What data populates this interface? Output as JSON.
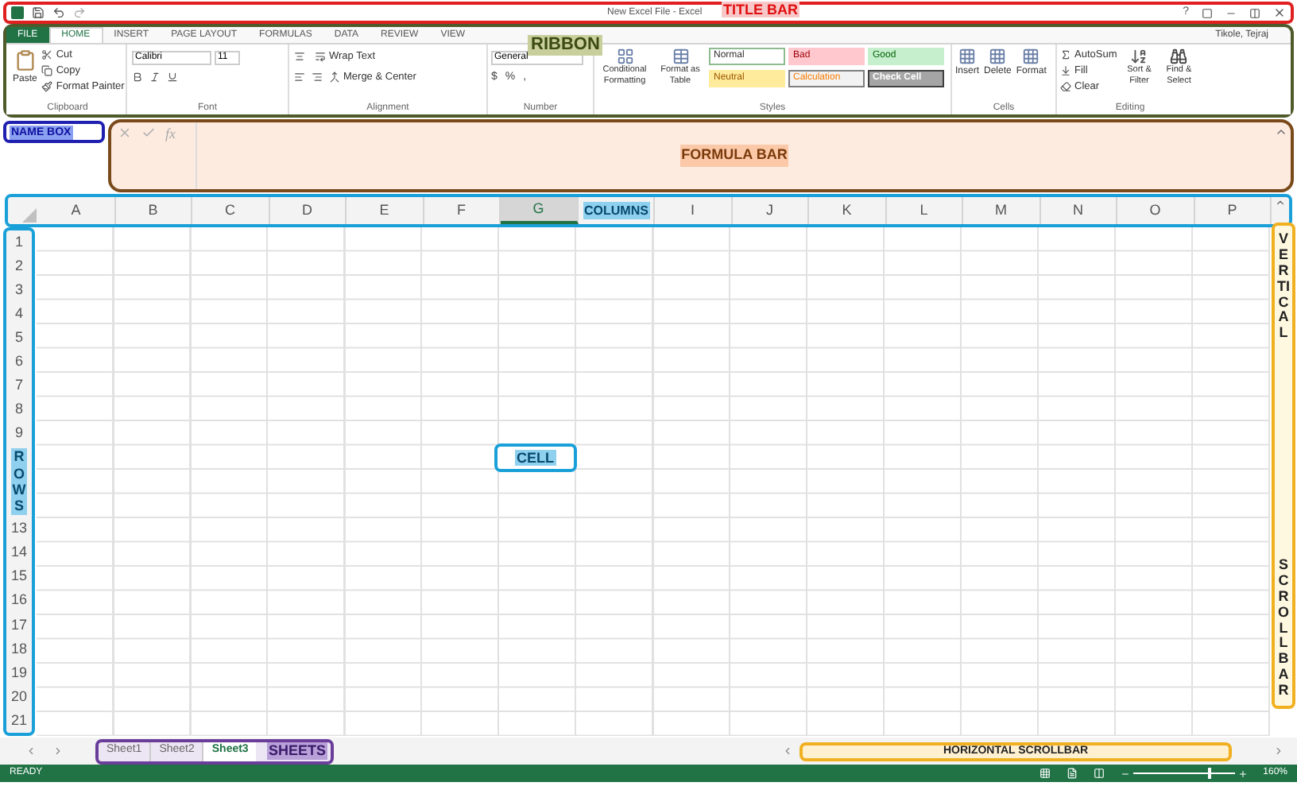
{
  "title_bar": {
    "title": "New Excel File - Excel",
    "annotation": "TITLE BAR",
    "help": "?"
  },
  "ribbon": {
    "annotation": "RIBBON",
    "user": "Tikole, Tejraj",
    "tabs": [
      {
        "label": "FILE",
        "kind": "file",
        "selected": false
      },
      {
        "label": "HOME",
        "kind": "tab",
        "selected": true
      },
      {
        "label": "INSERT",
        "kind": "tab",
        "selected": false
      },
      {
        "label": "PAGE LAYOUT",
        "kind": "tab",
        "selected": false
      },
      {
        "label": "FORMULAS",
        "kind": "tab",
        "selected": false
      },
      {
        "label": "DATA",
        "kind": "tab",
        "selected": false
      },
      {
        "label": "REVIEW",
        "kind": "tab",
        "selected": false
      },
      {
        "label": "VIEW",
        "kind": "tab",
        "selected": false
      }
    ],
    "clipboard": {
      "name": "Clipboard",
      "paste": "Paste",
      "cut": "Cut",
      "copy": "Copy",
      "painter": "Format Painter"
    },
    "font": {
      "name": "Font",
      "family": "Calibri",
      "size": "11"
    },
    "alignment": {
      "name": "Alignment",
      "wrap": "Wrap Text",
      "merge": "Merge & Center"
    },
    "number": {
      "name": "Number",
      "format": "General",
      "currency": "$",
      "percent": "%",
      "comma": ","
    },
    "styles": {
      "name": "Styles",
      "conditional": "Conditional Formatting",
      "table": "Format as Table",
      "cells": [
        {
          "label": "Normal",
          "kind": "normal"
        },
        {
          "label": "Bad",
          "kind": "bad"
        },
        {
          "label": "Good",
          "kind": "good"
        },
        {
          "label": "Neutral",
          "kind": "neutral"
        },
        {
          "label": "Calculation",
          "kind": "calculation"
        },
        {
          "label": "Check Cell",
          "kind": "check"
        }
      ]
    },
    "cells": {
      "name": "Cells",
      "insert": "Insert",
      "delete": "Delete",
      "format": "Format"
    },
    "editing": {
      "name": "Editing",
      "autosum": "AutoSum",
      "fill": "Fill",
      "clear": "Clear",
      "sort": "Sort & Filter",
      "find": "Find & Select"
    }
  },
  "name_box": {
    "annotation": "NAME BOX"
  },
  "formula_bar": {
    "fx": "fx",
    "annotation": "FORMULA BAR"
  },
  "columns": {
    "annotation": "COLUMNS",
    "headers": [
      {
        "kind": "header",
        "label": "A",
        "selected": false
      },
      {
        "kind": "header",
        "label": "B",
        "selected": false
      },
      {
        "kind": "header",
        "label": "C",
        "selected": false
      },
      {
        "kind": "header",
        "label": "D",
        "selected": false
      },
      {
        "kind": "header",
        "label": "E",
        "selected": false
      },
      {
        "kind": "header",
        "label": "F",
        "selected": false
      },
      {
        "kind": "header",
        "label": "G",
        "selected": true
      },
      {
        "kind": "annotation"
      },
      {
        "kind": "header",
        "label": "I",
        "selected": false
      },
      {
        "kind": "header",
        "label": "J",
        "selected": false
      },
      {
        "kind": "header",
        "label": "K",
        "selected": false
      },
      {
        "kind": "header",
        "label": "L",
        "selected": false
      },
      {
        "kind": "header",
        "label": "M",
        "selected": false
      },
      {
        "kind": "header",
        "label": "N",
        "selected": false
      },
      {
        "kind": "header",
        "label": "O",
        "selected": false
      },
      {
        "kind": "header",
        "label": "P",
        "selected": false
      }
    ]
  },
  "rows": {
    "annotation": "ROWS",
    "headers": [
      {
        "kind": "header",
        "label": "1"
      },
      {
        "kind": "header",
        "label": "2"
      },
      {
        "kind": "header",
        "label": "3"
      },
      {
        "kind": "header",
        "label": "4"
      },
      {
        "kind": "header",
        "label": "5"
      },
      {
        "kind": "header",
        "label": "6"
      },
      {
        "kind": "header",
        "label": "7"
      },
      {
        "kind": "header",
        "label": "8"
      },
      {
        "kind": "header",
        "label": "9"
      },
      {
        "kind": "annotation"
      },
      {
        "kind": "header",
        "label": "13"
      },
      {
        "kind": "header",
        "label": "14"
      },
      {
        "kind": "header",
        "label": "15"
      },
      {
        "kind": "header",
        "label": "16"
      },
      {
        "kind": "header",
        "label": "17"
      },
      {
        "kind": "header",
        "label": "18"
      },
      {
        "kind": "header",
        "label": "19"
      },
      {
        "kind": "header",
        "label": "20"
      },
      {
        "kind": "header",
        "label": "21"
      }
    ]
  },
  "cell": {
    "annotation": "CELL"
  },
  "vertical_scrollbar": {
    "annotation_top": "VERTICAL",
    "annotation_bottom": "SCROLLBAR"
  },
  "sheets": {
    "annotation": "SHEETS",
    "tabs": [
      {
        "label": "Sheet1",
        "selected": false
      },
      {
        "label": "Sheet2",
        "selected": false
      },
      {
        "label": "Sheet3",
        "selected": true
      }
    ]
  },
  "horizontal_scrollbar": {
    "annotation": "HORIZONTAL SCROLLBAR"
  },
  "status_bar": {
    "status": "READY",
    "zoom": "160%",
    "zoom_slider": {
      "level": 0.75
    }
  }
}
